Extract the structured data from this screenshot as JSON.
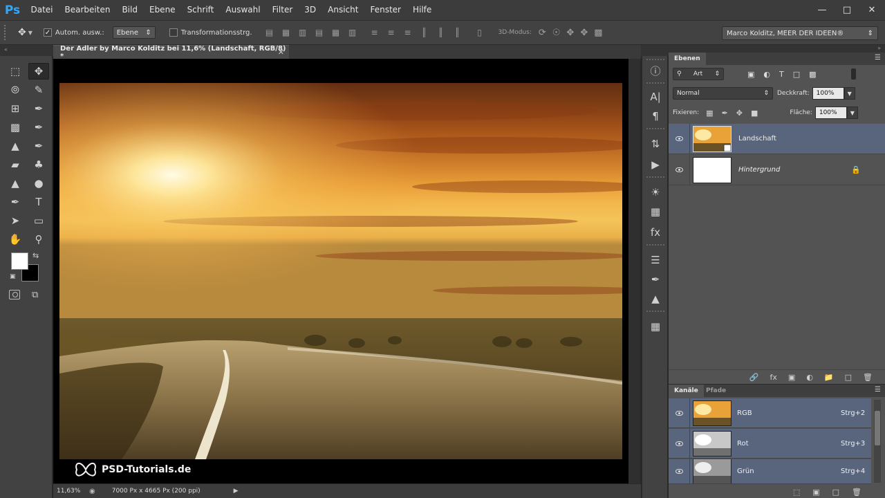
{
  "app": {
    "logo": "Ps",
    "menu": [
      "Datei",
      "Bearbeiten",
      "Bild",
      "Ebene",
      "Schrift",
      "Auswahl",
      "Filter",
      "3D",
      "Ansicht",
      "Fenster",
      "Hilfe"
    ],
    "window_controls": [
      "minimize-icon",
      "maximize-icon",
      "close-icon"
    ]
  },
  "options_bar": {
    "auto_select_label": "Autom. ausw.:",
    "auto_select_checked": true,
    "auto_select_target": "Ebene",
    "transform_label": "Transformationsstrg.",
    "transform_checked": false,
    "mode_3d_label": "3D-Modus:",
    "workspace": "Marco Kolditz, MEER DER IDEEN®"
  },
  "document": {
    "tab_title": "Der Adler by Marco Kolditz bei 11,6% (Landschaft, RGB/8) *",
    "watermark": "PSD-Tutorials.de",
    "zoom": "11,63%",
    "doc_info": "7000 Px x 4665 Px (200 ppi)"
  },
  "tools": {
    "foreground": "#ffffff",
    "background": "#000000",
    "items": [
      "marquee-tool",
      "move-tool",
      "lasso-tool",
      "quick-selection-tool",
      "crop-tool",
      "eyedropper-tool",
      "spot-healing-tool",
      "brush-tool",
      "clone-stamp-tool",
      "history-brush-tool",
      "eraser-tool",
      "paint-bucket-tool",
      "blur-tool",
      "dodge-tool",
      "pen-tool",
      "type-tool",
      "path-selection-tool",
      "rectangle-tool",
      "hand-tool",
      "zoom-tool"
    ],
    "type_glyph": "T"
  },
  "layers_panel": {
    "tab": "Ebenen",
    "filter_kind": "Art",
    "blend_mode": "Normal",
    "opacity_label": "Deckkraft:",
    "opacity": "100%",
    "lock_label": "Fixieren:",
    "fill_label": "Fläche:",
    "fill": "100%",
    "layers": [
      {
        "name": "Landschaft",
        "selected": true,
        "locked": false
      },
      {
        "name": "Hintergrund",
        "selected": false,
        "locked": true
      }
    ]
  },
  "channels_panel": {
    "tabs": [
      "Kanäle",
      "Pfade"
    ],
    "channels": [
      {
        "name": "RGB",
        "shortcut": "Strg+2"
      },
      {
        "name": "Rot",
        "shortcut": "Strg+3"
      },
      {
        "name": "Grün",
        "shortcut": "Strg+4"
      }
    ]
  }
}
